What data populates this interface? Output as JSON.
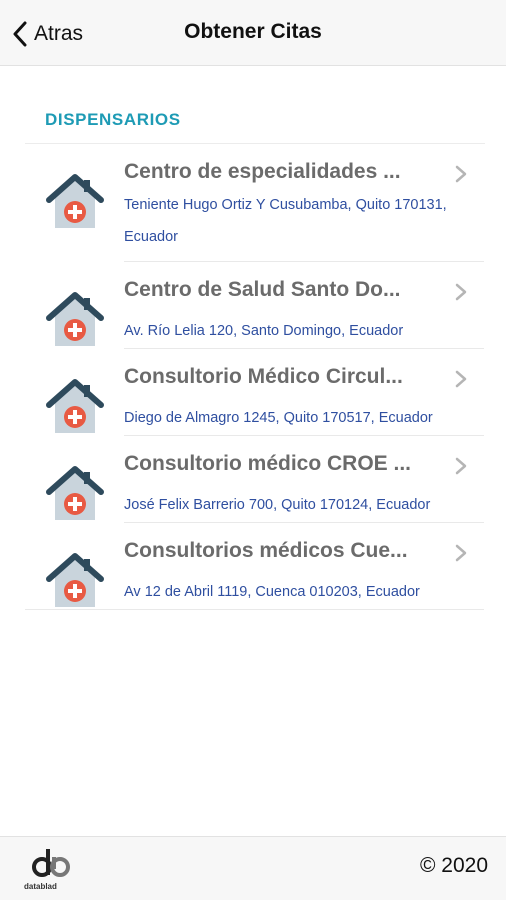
{
  "header": {
    "back_label": "Atras",
    "title": "Obtener Citas"
  },
  "section": {
    "title": "DISPENSARIOS"
  },
  "items": [
    {
      "name": "Centro de especialidades ...",
      "address": "Teniente Hugo Ortiz Y Cusubamba, Quito 170131, Ecuador"
    },
    {
      "name": "Centro de Salud Santo Do...",
      "address": "Av. Río Lelia 120, Santo Domingo, Ecuador"
    },
    {
      "name": "Consultorio Médico Circul...",
      "address": "Diego de Almagro 1245, Quito 170517, Ecuador"
    },
    {
      "name": "Consultorio médico CROE ...",
      "address": "José Felix Barrerio 700, Quito 170124, Ecuador"
    },
    {
      "name": "Consultorios médicos Cue...",
      "address": "Av 12 de Abril 1119, Cuenca 010203, Ecuador"
    }
  ],
  "footer": {
    "logo_text": "datablad",
    "copyright": "© 2020"
  },
  "icons": {
    "back": "chevron-left-icon",
    "item": "medical-house-icon",
    "disclosure": "chevron-right-icon"
  },
  "colors": {
    "section_title": "#1e9bb5",
    "item_name": "#6b6b6b",
    "address": "#2f4fa0",
    "house_roof": "#2e4a5c",
    "house_body": "#c9d4dc",
    "cross_circle": "#e85a43"
  }
}
